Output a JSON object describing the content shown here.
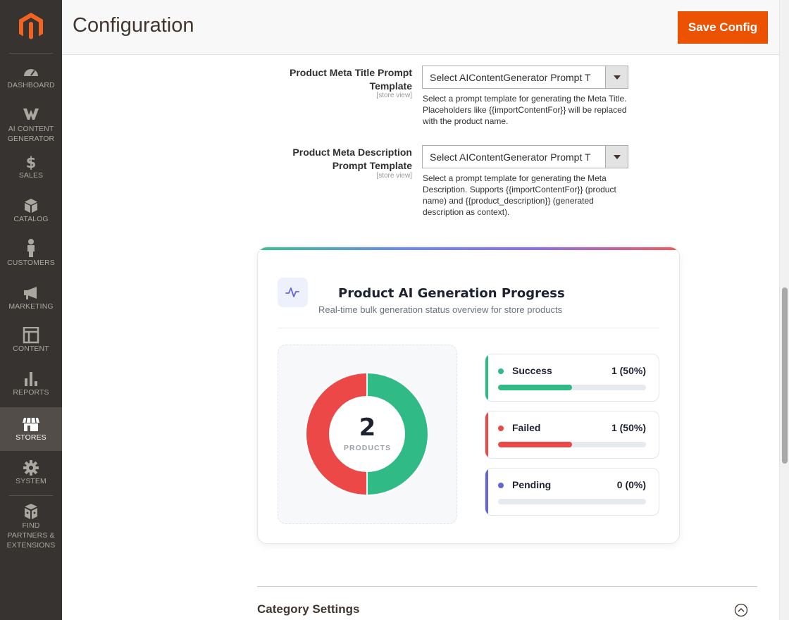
{
  "sidebar": {
    "logo": "magento-logo",
    "items": [
      {
        "label": "DASHBOARD",
        "icon": "dashboard-icon",
        "active": false
      },
      {
        "label": "AI CONTENT GENERATOR",
        "icon": "ai-content-generator-icon",
        "active": false
      },
      {
        "label": "SALES",
        "icon": "dollar-icon",
        "active": false
      },
      {
        "label": "CATALOG",
        "icon": "cube-icon",
        "active": false
      },
      {
        "label": "CUSTOMERS",
        "icon": "person-icon",
        "active": false
      },
      {
        "label": "MARKETING",
        "icon": "megaphone-icon",
        "active": false
      },
      {
        "label": "CONTENT",
        "icon": "layout-icon",
        "active": false
      },
      {
        "label": "REPORTS",
        "icon": "bar-chart-icon",
        "active": false
      },
      {
        "label": "STORES",
        "icon": "storefront-icon",
        "active": true
      },
      {
        "label": "SYSTEM",
        "icon": "gear-icon",
        "active": false
      },
      {
        "label": "FIND PARTNERS & EXTENSIONS",
        "icon": "blocks-icon",
        "active": false
      }
    ]
  },
  "header": {
    "title": "Configuration",
    "save_label": "Save Config"
  },
  "fields": {
    "meta_title": {
      "label": "Product Meta Title Prompt Template",
      "scope": "[store view]",
      "value": "Select AIContentGenerator Prompt T",
      "note": "Select a prompt template for generating the Meta Title. Placeholders like {{importContentFor}} will be replaced with the product name."
    },
    "meta_description": {
      "label": "Product Meta Description Prompt Template",
      "scope": "[store view]",
      "value": "Select AIContentGenerator Prompt T",
      "note": "Select a prompt template for generating the Meta Description. Supports {{importContentFor}} (product name) and {{product_description}} (generated description as context)."
    }
  },
  "progress": {
    "icon": "activity-pulse-icon",
    "title": "Product AI Generation Progress",
    "subtitle": "Real-time bulk generation status overview for store products",
    "total": "2",
    "total_caption": "PRODUCTS",
    "stats": [
      {
        "label": "Success",
        "value": "1 (50%)",
        "fraction": 0.5,
        "color": "#2fba86"
      },
      {
        "label": "Failed",
        "value": "1 (50%)",
        "fraction": 0.5,
        "color": "#ec4848"
      },
      {
        "label": "Pending",
        "value": "0 (0%)",
        "fraction": 0.0,
        "color": "#6366d6"
      }
    ]
  },
  "chart_data": {
    "type": "pie",
    "categories": [
      "Success",
      "Failed",
      "Pending"
    ],
    "values": [
      1,
      1,
      0
    ],
    "colors": [
      "#2fba86",
      "#ec4848",
      "#6366d6"
    ]
  },
  "category_settings": {
    "title": "Category Settings",
    "icon": "chevron-up-circle-icon"
  }
}
